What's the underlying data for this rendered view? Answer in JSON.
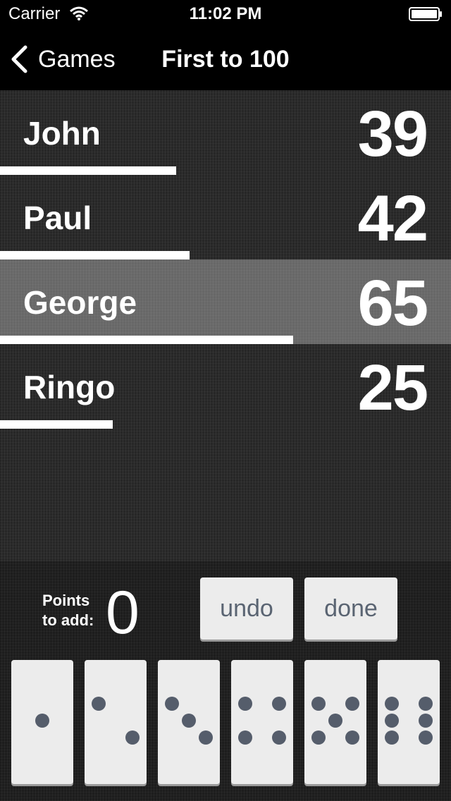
{
  "status_bar": {
    "carrier": "Carrier",
    "time": "11:02 PM"
  },
  "nav": {
    "back_label": "Games",
    "title": "First to 100"
  },
  "players": [
    {
      "name": "John",
      "score": "39",
      "progress": 0.39,
      "selected": false
    },
    {
      "name": "Paul",
      "score": "42",
      "progress": 0.42,
      "selected": false
    },
    {
      "name": "George",
      "score": "65",
      "progress": 0.65,
      "selected": true
    },
    {
      "name": "Ringo",
      "score": "25",
      "progress": 0.25,
      "selected": false
    }
  ],
  "controls": {
    "points_label": "Points to add:",
    "points_value": "0",
    "undo_label": "undo",
    "done_label": "done"
  },
  "dice": [
    {
      "value": 1,
      "icon": "die-one-icon"
    },
    {
      "value": 2,
      "icon": "die-two-icon"
    },
    {
      "value": 3,
      "icon": "die-three-icon"
    },
    {
      "value": 4,
      "icon": "die-four-icon"
    },
    {
      "value": 5,
      "icon": "die-five-icon"
    },
    {
      "value": 6,
      "icon": "die-six-icon"
    }
  ],
  "colors": {
    "pip": "#555d6b",
    "button_text": "#5a6472"
  }
}
